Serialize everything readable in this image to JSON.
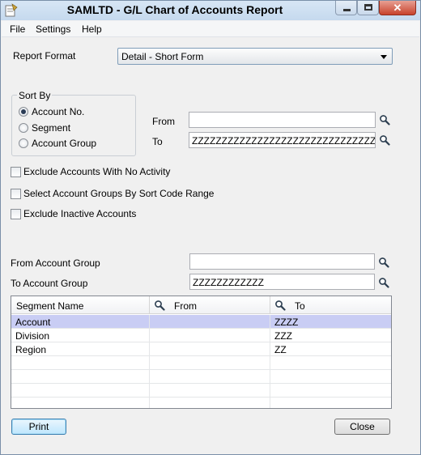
{
  "window": {
    "title": "SAMLTD - G/L Chart of Accounts Report"
  },
  "menu": {
    "items": [
      "File",
      "Settings",
      "Help"
    ]
  },
  "report_format": {
    "label": "Report Format",
    "value": "Detail - Short Form"
  },
  "sort_by": {
    "legend": "Sort By",
    "options": [
      "Account No.",
      "Segment",
      "Account Group"
    ],
    "selected": "Account No."
  },
  "range": {
    "from_label": "From",
    "to_label": "To",
    "from_value": "",
    "to_value": "ZZZZZZZZZZZZZZZZZZZZZZZZZZZZZZZZZZZZZZZZZZZZ"
  },
  "options": {
    "exclude_no_activity": {
      "label": "Exclude Accounts With No Activity",
      "checked": false
    },
    "select_groups_sort_code": {
      "label": "Select Account Groups By Sort Code Range",
      "checked": false
    },
    "exclude_inactive": {
      "label": "Exclude Inactive Accounts",
      "checked": false
    }
  },
  "account_group": {
    "from_label": "From Account Group",
    "from_value": "",
    "to_label": "To Account Group",
    "to_value": "ZZZZZZZZZZZZ"
  },
  "segment_table": {
    "columns": [
      "Segment Name",
      "From",
      "To"
    ],
    "rows": [
      {
        "name": "Account",
        "from": "",
        "to": "ZZZZ"
      },
      {
        "name": "Division",
        "from": "",
        "to": "ZZZ"
      },
      {
        "name": "Region",
        "from": "",
        "to": "ZZ"
      }
    ],
    "selected_row": 0
  },
  "buttons": {
    "print": "Print",
    "close": "Close"
  },
  "icons": {
    "finder": "magnifier-icon",
    "app": "report-app-icon"
  },
  "colors": {
    "selected_row": "#c9cdf4",
    "titlebar": "#c5d9ee",
    "close_button": "#c7432c"
  }
}
